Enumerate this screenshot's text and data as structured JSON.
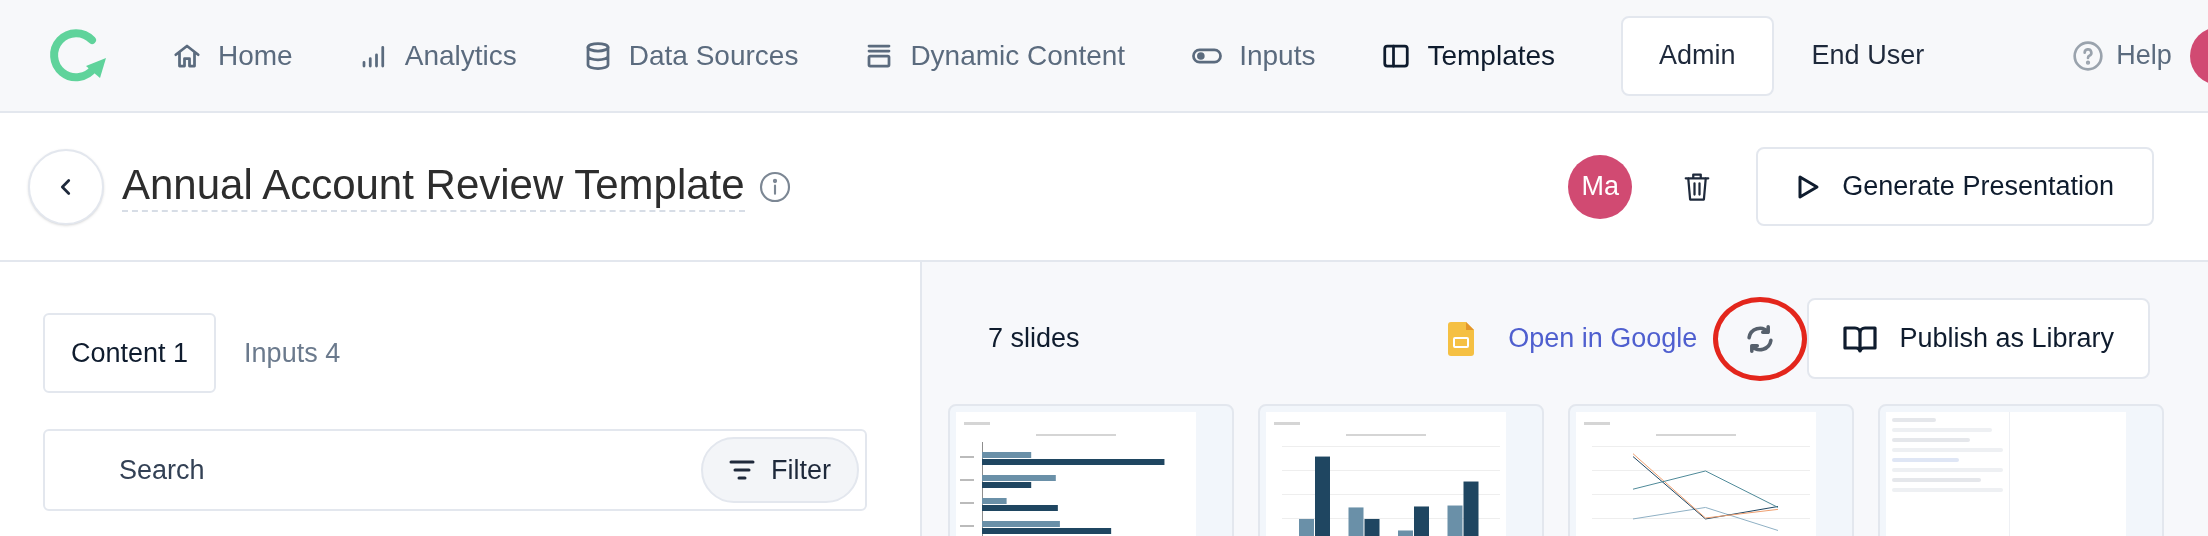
{
  "nav": {
    "items": [
      {
        "label": "Home",
        "selected": false
      },
      {
        "label": "Analytics",
        "selected": false
      },
      {
        "label": "Data Sources",
        "selected": false
      },
      {
        "label": "Dynamic Content",
        "selected": false
      },
      {
        "label": "Inputs",
        "selected": false
      },
      {
        "label": "Templates",
        "selected": true
      }
    ],
    "roles": [
      {
        "label": "Admin",
        "selected": true
      },
      {
        "label": "End User",
        "selected": false
      }
    ],
    "help": "Help"
  },
  "header": {
    "title": "Annual Account Review Template",
    "avatar": "Ma",
    "primary_button": "Generate Presentation"
  },
  "left_panel": {
    "tabs": [
      {
        "label": "Content 1",
        "selected": true
      },
      {
        "label": "Inputs 4",
        "selected": false
      }
    ],
    "search": {
      "placeholder": "Search"
    },
    "filter_button": "Filter"
  },
  "right_panel": {
    "slide_count": "7 slides",
    "open_link": "Open in Google",
    "publish_button": "Publish as Library",
    "slides": [
      {
        "kind": "hbar"
      },
      {
        "kind": "vbar"
      },
      {
        "kind": "line"
      },
      {
        "kind": "screenshot"
      }
    ]
  }
}
